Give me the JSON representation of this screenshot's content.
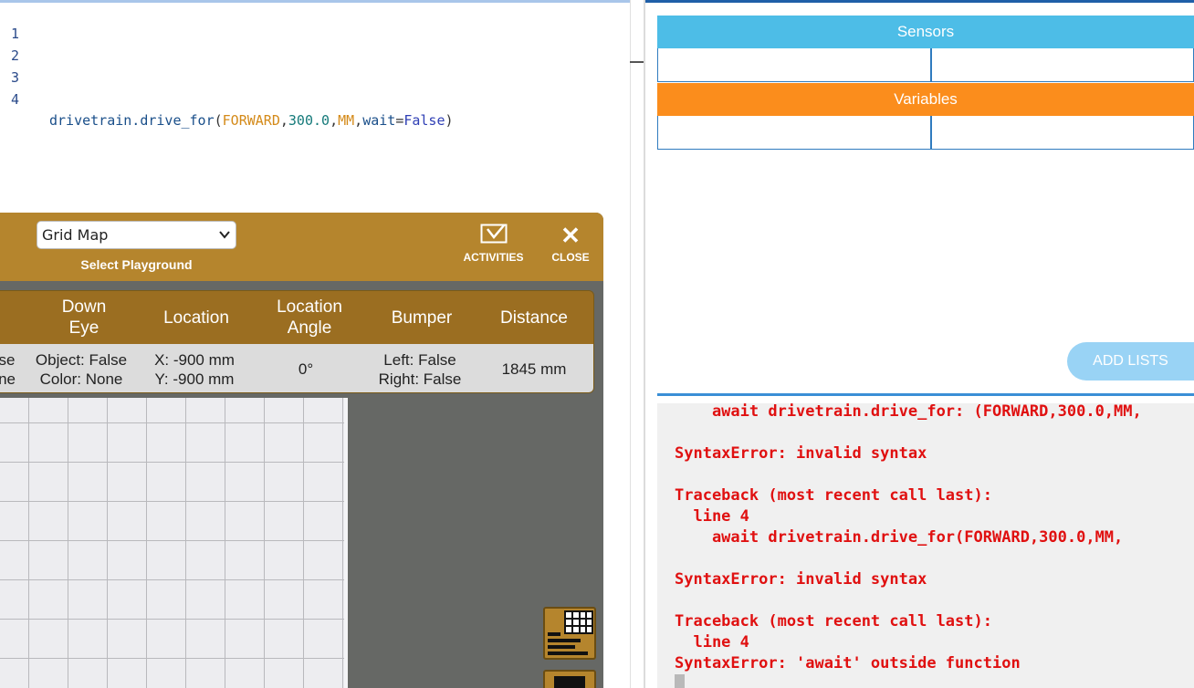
{
  "editor": {
    "lines": [
      {
        "num": "1"
      },
      {
        "num": "2"
      },
      {
        "num": "3"
      },
      {
        "num": "4",
        "fn": "drivetrain.drive_for",
        "open": "(",
        "forward": "FORWARD",
        "c1": ",",
        "dist": "300.0",
        "c2": ",",
        "units": "MM",
        "c3": ",",
        "kw": "wait",
        "eq": "=",
        "val": "False",
        "close": ")"
      }
    ]
  },
  "playground": {
    "select_value": "Grid Map",
    "select_label": "Select Playground",
    "activities_label": "ACTIVITIES",
    "close_label": "CLOSE",
    "close_glyph": "✕",
    "table": {
      "headers": [
        "",
        "Down\nEye",
        "Location",
        "Location\nAngle",
        "Bumper",
        "Distance"
      ],
      "values": [
        "se\nne",
        "Object: False\nColor: None",
        "X: -900 mm\nY: -900 mm",
        "0°",
        "Left: False\nRight: False",
        "1845 mm"
      ]
    }
  },
  "right_panel": {
    "sensors_title": "Sensors",
    "variables_title": "Variables",
    "add_lists_label": "ADD LISTS"
  },
  "console": {
    "lines": [
      "    await drivetrain.drive_for: (FORWARD,300.0,MM,",
      "",
      "SyntaxError: invalid syntax",
      "",
      "Traceback (most recent call last):",
      "  line 4",
      "    await drivetrain.drive_for(FORWARD,300.0,MM,",
      "",
      "SyntaxError: invalid syntax",
      "",
      "Traceback (most recent call last):",
      "  line 4",
      "SyntaxError: 'await' outside function"
    ]
  },
  "colors": {
    "playground_header": "#b5852d",
    "sensors": "#4dbde7",
    "variables": "#fb8d1c",
    "error_text": "#e01010"
  },
  "icons": [
    "activities-icon",
    "close-icon",
    "sensor-panel-icon",
    "monitor-icon"
  ]
}
